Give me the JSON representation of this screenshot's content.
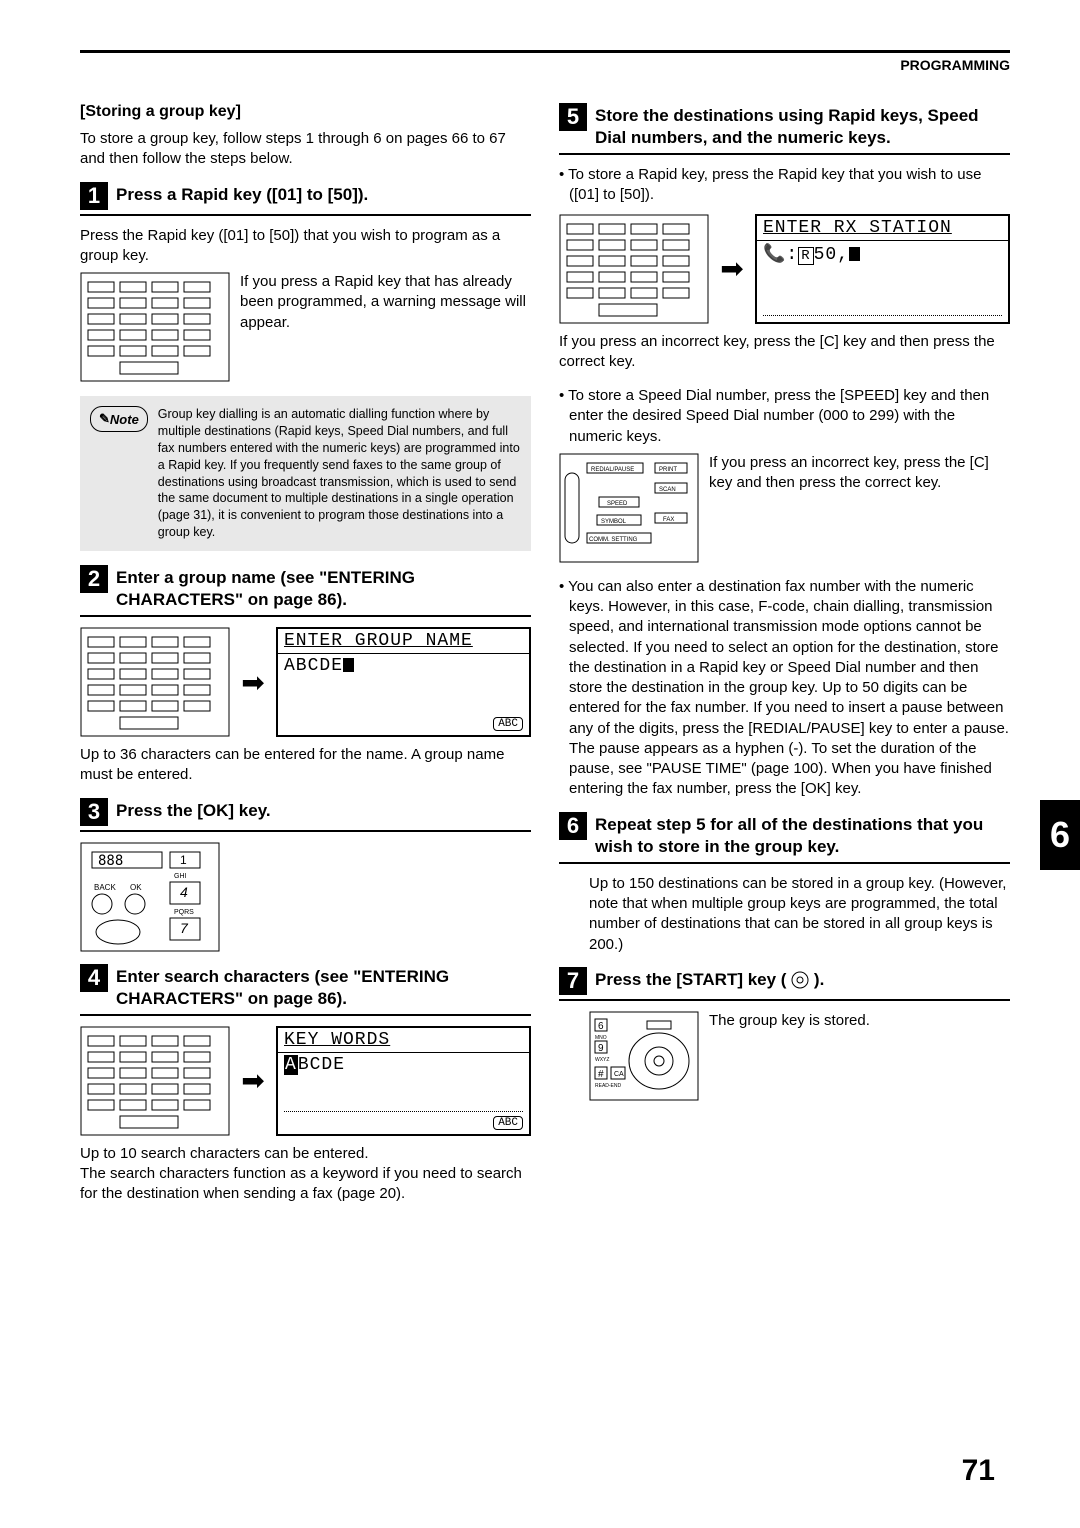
{
  "header": {
    "section": "PROGRAMMING"
  },
  "side_tab": "6",
  "page_number": "71",
  "left": {
    "sub1_title": "[Storing a group key]",
    "sub1_body": "To store a group key, follow steps 1 through 6 on pages 66 to 67 and then follow the steps below.",
    "step1_title": "Press a Rapid key ([01] to [50]).",
    "step1_body": "Press the Rapid key ([01] to [50]) that you wish to program as a group key.",
    "step1_side": "If you press a Rapid key that has already been programmed, a warning message will appear.",
    "note_label": "Note",
    "note_body": "Group key dialling is an automatic dialling function where by multiple destinations (Rapid keys, Speed Dial numbers, and full fax numbers entered with the numeric keys) are programmed into a Rapid key. If you frequently send faxes to the same group of destinations using broadcast transmission, which is used to send the same document to multiple destinations in a single operation (page 31), it is convenient to program those destinations into a group key.",
    "step2_title": "Enter a group name (see \"ENTERING CHARACTERS\" on page 86).",
    "lcd1_line1": "ENTER GROUP NAME",
    "lcd1_line2": "ABCDE",
    "lcd1_badge": "ABC",
    "step2_after": "Up to 36 characters can be entered for the name. A group name must be entered.",
    "step3_title": "Press the [OK] key.",
    "step4_title": "Enter search characters (see \"ENTERING CHARACTERS\" on page 86).",
    "lcd2_line1": "KEY WORDS",
    "lcd2_line2": "BCDE",
    "lcd2_badge": "ABC",
    "step4_after": "Up to 10 search characters can be entered.\nThe search characters function as a keyword if you need to search for the destination when sending a fax (page 20)."
  },
  "right": {
    "step5_title": "Store the destinations using Rapid keys, Speed Dial numbers, and the numeric keys.",
    "step5_b1": "To store a Rapid key, press the Rapid key that you wish to use ([01] to [50]).",
    "lcd3_line1": "ENTER RX STATION",
    "lcd3_line2_before": "   :  ",
    "lcd3_line2_val": "R 50,",
    "step5_after1": "If you press an incorrect key, press the [C] key and then press the correct key.",
    "step5_b2": "To store a Speed Dial number, press the [SPEED] key and then enter the desired Speed Dial number (000 to 299) with the numeric keys.",
    "step5_side2": "If you press an incorrect key, press the [C] key and then press the correct key.",
    "step5_b3": "You can also enter a destination fax number with the numeric keys. However, in this case, F-code, chain dialling, transmission speed, and international transmission mode options cannot be selected. If you need to select an option for the destination, store the destination in a Rapid key or Speed Dial number and then store the destination in the group key. Up to 50 digits can be entered for the fax number. If you need to insert a pause between any of the digits, press the [REDIAL/PAUSE] key to enter a pause. The pause appears as a hyphen (-). To set the duration of the pause, see \"PAUSE TIME\" (page 100). When you have finished entering the fax number, press the [OK] key.",
    "step6_title": "Repeat step 5 for all of the destinations that you wish to store in the group key.",
    "step6_body": "Up to 150 destinations can be stored in a group key. (However, note that when multiple group keys are programmed, the total number of destinations that can be stored in all group keys is 200.)",
    "step7_title": "Press the [START] key (   ).",
    "step7_body": "The group key is stored."
  }
}
